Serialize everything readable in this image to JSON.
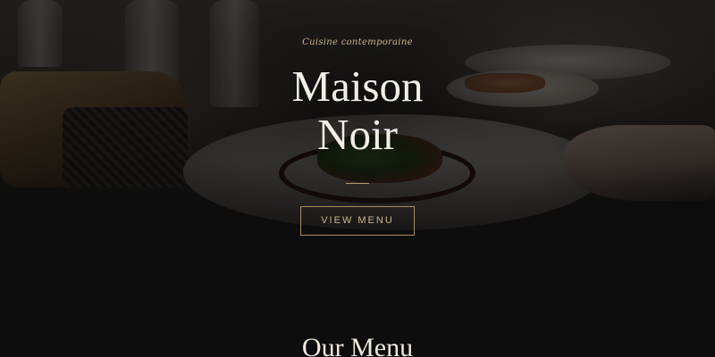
{
  "hero": {
    "tagline": "Cuisine contemporaine",
    "title_line1": "Maison",
    "title_line2": "Noir",
    "cta_label": "VIEW MENU"
  },
  "menu_section": {
    "heading": "Our Menu"
  },
  "colors": {
    "accent_gold": "#c9b58a",
    "background": "#0e0d0d",
    "title_text": "#f3efe8"
  }
}
